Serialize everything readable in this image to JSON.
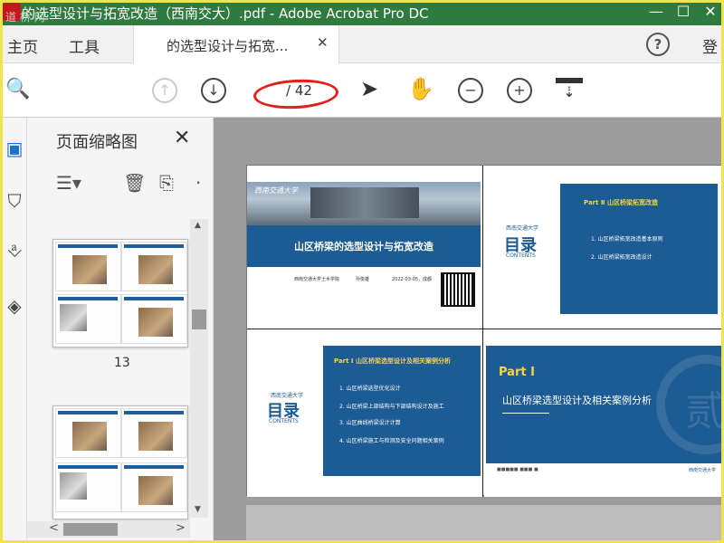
{
  "window": {
    "title": "的选型设计与拓宽改造（西南交大）.pdf - Adobe Acrobat Pro DC",
    "watermark": "道 桥 网",
    "min_glyph": "—",
    "max_glyph": "☐",
    "close_glyph": "✕"
  },
  "tabs": {
    "home": "主页",
    "tools": "工具",
    "doc_tab": "的选型设计与拓宽...",
    "doc_close": "✕",
    "help": "?",
    "login": "登"
  },
  "toolbar": {
    "search_icon": "🔍",
    "prev_page_icon": "↑",
    "next_page_icon": "↓",
    "current_page": "",
    "total_pages": "/ 42",
    "select_icon": "➤",
    "hand_icon": "✋",
    "zoom_out_icon": "−",
    "zoom_in_icon": "+",
    "scroll_mode_icon": "⇣"
  },
  "sidebar_icons": [
    "page-thumbnails-icon",
    "bookmark-icon",
    "attachment-icon",
    "layers-icon"
  ],
  "thumb_panel": {
    "title": "页面缩略图",
    "close": "✕",
    "options_icon": "☰▾",
    "delete_icon": "🗑",
    "insert_icon": "⎘",
    "more": "·",
    "page_label": "13",
    "collapse_arrow": "◀",
    "scroll_left": "<",
    "scroll_right": ">",
    "scroll_up": "▲",
    "scroll_down": "▼"
  },
  "slides": {
    "s1": {
      "school": "西南交通大学",
      "title": "山区桥梁的选型设计与拓宽改造",
      "org": "西南交通大学土木学院",
      "author": "孙俊雄",
      "date": "2022-03-05，成都"
    },
    "s2": {
      "heading": "Part  Ⅱ   山区桥梁拓宽改造",
      "items": [
        "1.  山区桥梁拓宽改造基本原则",
        "2.  山区桥梁拓宽改造设计"
      ],
      "logo": "西南交通大学",
      "mulu": "目录",
      "contents": "CONTENTS"
    },
    "s3": {
      "heading": "Part  Ⅰ  山区桥梁选型设计及相关案例分析",
      "items": [
        "1.  山区桥梁选型优化设计",
        "2.  山区桥梁上部结构与下部结构设计及施工",
        "3.  山区曲线桥梁设计计算",
        "4.  山区桥梁施工与检测及安全问题相关案例"
      ],
      "logo": "西南交通大学",
      "mulu": "目录",
      "contents": "CONTENTS"
    },
    "s4": {
      "part": "Part  Ⅰ",
      "title": "山区桥梁选型设计及相关案例分析",
      "seal": "贰",
      "foot": "■■■■■  ■■■ ■",
      "foot2": "西南交通大学"
    }
  }
}
